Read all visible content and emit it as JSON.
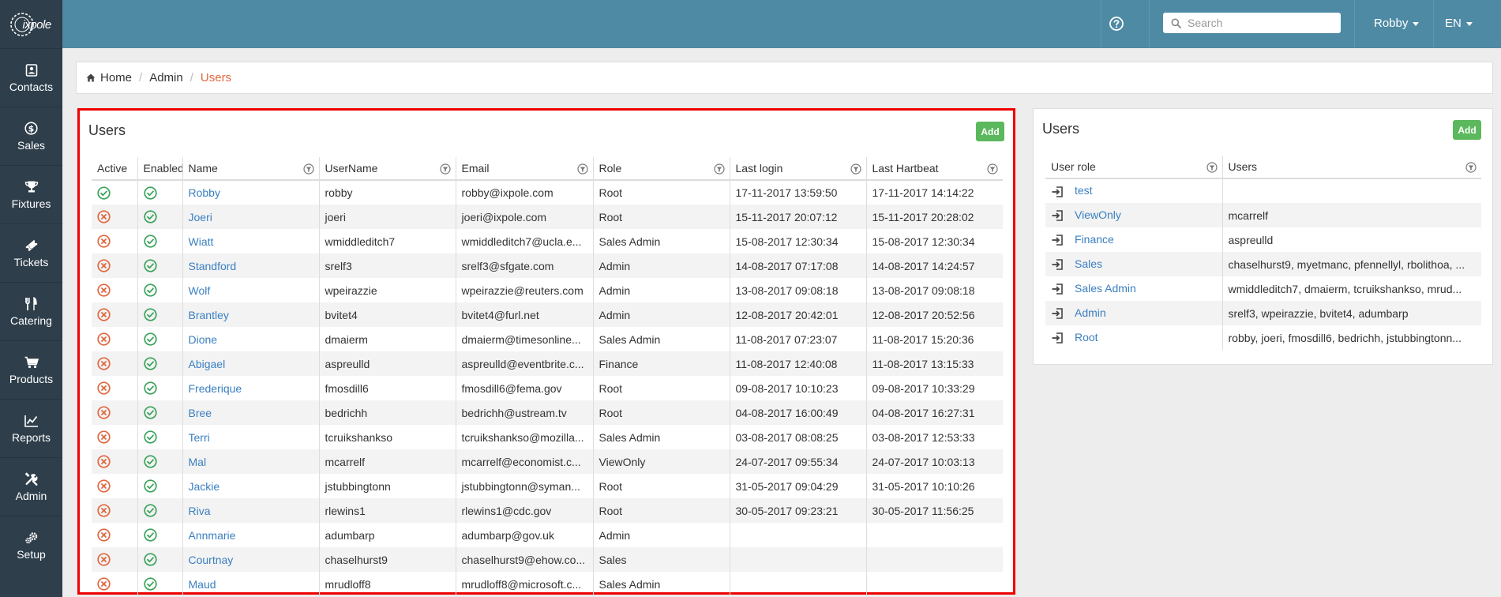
{
  "app": {
    "logo_text": "ixpole"
  },
  "sidebar": {
    "items": [
      {
        "key": "contacts",
        "label": "Contacts",
        "icon": "contact-card-icon"
      },
      {
        "key": "sales",
        "label": "Sales",
        "icon": "dollar-icon"
      },
      {
        "key": "fixtures",
        "label": "Fixtures",
        "icon": "trophy-icon"
      },
      {
        "key": "tickets",
        "label": "Tickets",
        "icon": "ticket-icon"
      },
      {
        "key": "catering",
        "label": "Catering",
        "icon": "cutlery-icon"
      },
      {
        "key": "products",
        "label": "Products",
        "icon": "cart-icon"
      },
      {
        "key": "reports",
        "label": "Reports",
        "icon": "chart-icon"
      },
      {
        "key": "admin",
        "label": "Admin",
        "icon": "tools-icon"
      },
      {
        "key": "setup",
        "label": "Setup",
        "icon": "gears-icon"
      }
    ]
  },
  "topbar": {
    "search_placeholder": "Search",
    "user_name": "Robby",
    "language": "EN"
  },
  "breadcrumb": {
    "home": "Home",
    "admin": "Admin",
    "current": "Users"
  },
  "users_panel": {
    "title": "Users",
    "add_label": "Add",
    "columns": [
      "Active",
      "Enabled",
      "Name",
      "UserName",
      "Email",
      "Role",
      "Last login",
      "Last Hartbeat"
    ],
    "rows": [
      {
        "active": true,
        "enabled": true,
        "name": "Robby",
        "username": "robby",
        "email": "robby@ixpole.com",
        "role": "Root",
        "last_login": "17-11-2017 13:59:50",
        "last_heartbeat": "17-11-2017 14:14:22"
      },
      {
        "active": false,
        "enabled": true,
        "name": "Joeri",
        "username": "joeri",
        "email": "joeri@ixpole.com",
        "role": "Root",
        "last_login": "15-11-2017 20:07:12",
        "last_heartbeat": "15-11-2017 20:28:02"
      },
      {
        "active": false,
        "enabled": true,
        "name": "Wiatt",
        "username": "wmiddleditch7",
        "email": "wmiddleditch7@ucla.e...",
        "role": "Sales Admin",
        "last_login": "15-08-2017 12:30:34",
        "last_heartbeat": "15-08-2017 12:30:34"
      },
      {
        "active": false,
        "enabled": true,
        "name": "Standford",
        "username": "srelf3",
        "email": "srelf3@sfgate.com",
        "role": "Admin",
        "last_login": "14-08-2017 07:17:08",
        "last_heartbeat": "14-08-2017 14:24:57"
      },
      {
        "active": false,
        "enabled": true,
        "name": "Wolf",
        "username": "wpeirazzie",
        "email": "wpeirazzie@reuters.com",
        "role": "Admin",
        "last_login": "13-08-2017 09:08:18",
        "last_heartbeat": "13-08-2017 09:08:18"
      },
      {
        "active": false,
        "enabled": true,
        "name": "Brantley",
        "username": "bvitet4",
        "email": "bvitet4@furl.net",
        "role": "Admin",
        "last_login": "12-08-2017 20:42:01",
        "last_heartbeat": "12-08-2017 20:52:56"
      },
      {
        "active": false,
        "enabled": true,
        "name": "Dione",
        "username": "dmaierm",
        "email": "dmaierm@timesonline...",
        "role": "Sales Admin",
        "last_login": "11-08-2017 07:23:07",
        "last_heartbeat": "11-08-2017 15:20:36"
      },
      {
        "active": false,
        "enabled": true,
        "name": "Abigael",
        "username": "aspreulld",
        "email": "aspreulld@eventbrite.c...",
        "role": "Finance",
        "last_login": "11-08-2017 12:40:08",
        "last_heartbeat": "11-08-2017 13:15:33"
      },
      {
        "active": false,
        "enabled": true,
        "name": "Frederique",
        "username": "fmosdill6",
        "email": "fmosdill6@fema.gov",
        "role": "Root",
        "last_login": "09-08-2017 10:10:23",
        "last_heartbeat": "09-08-2017 10:33:29"
      },
      {
        "active": false,
        "enabled": true,
        "name": "Bree",
        "username": "bedrichh",
        "email": "bedrichh@ustream.tv",
        "role": "Root",
        "last_login": "04-08-2017 16:00:49",
        "last_heartbeat": "04-08-2017 16:27:31"
      },
      {
        "active": false,
        "enabled": true,
        "name": "Terri",
        "username": "tcruikshankso",
        "email": "tcruikshankso@mozilla...",
        "role": "Sales Admin",
        "last_login": "03-08-2017 08:08:25",
        "last_heartbeat": "03-08-2017 12:53:33"
      },
      {
        "active": false,
        "enabled": true,
        "name": "Mal",
        "username": "mcarrelf",
        "email": "mcarrelf@economist.c...",
        "role": "ViewOnly",
        "last_login": "24-07-2017 09:55:34",
        "last_heartbeat": "24-07-2017 10:03:13"
      },
      {
        "active": false,
        "enabled": true,
        "name": "Jackie",
        "username": "jstubbingtonn",
        "email": "jstubbingtonn@syman...",
        "role": "Root",
        "last_login": "31-05-2017 09:04:29",
        "last_heartbeat": "31-05-2017 10:10:26"
      },
      {
        "active": false,
        "enabled": true,
        "name": "Riva",
        "username": "rlewins1",
        "email": "rlewins1@cdc.gov",
        "role": "Root",
        "last_login": "30-05-2017 09:23:21",
        "last_heartbeat": "30-05-2017 11:56:25"
      },
      {
        "active": false,
        "enabled": true,
        "name": "Annmarie",
        "username": "adumbarp",
        "email": "adumbarp@gov.uk",
        "role": "Admin",
        "last_login": "",
        "last_heartbeat": ""
      },
      {
        "active": false,
        "enabled": true,
        "name": "Courtnay",
        "username": "chaselhurst9",
        "email": "chaselhurst9@ehow.co...",
        "role": "Sales",
        "last_login": "",
        "last_heartbeat": ""
      },
      {
        "active": false,
        "enabled": true,
        "name": "Maud",
        "username": "mrudloff8",
        "email": "mrudloff8@microsoft.c...",
        "role": "Sales Admin",
        "last_login": "",
        "last_heartbeat": ""
      }
    ]
  },
  "roles_panel": {
    "title": "Users",
    "add_label": "Add",
    "columns": [
      "User role",
      "Users"
    ],
    "rows": [
      {
        "role": "test",
        "users": ""
      },
      {
        "role": "ViewOnly",
        "users": "mcarrelf"
      },
      {
        "role": "Finance",
        "users": "aspreulld"
      },
      {
        "role": "Sales",
        "users": "chaselhurst9, myetmanc, pfennellyl, rbolithoa, ..."
      },
      {
        "role": "Sales Admin",
        "users": "wmiddleditch7, dmaierm, tcruikshankso, mrud..."
      },
      {
        "role": "Admin",
        "users": "srelf3, wpeirazzie, bvitet4, adumbarp"
      },
      {
        "role": "Root",
        "users": "robby, joeri, fmosdill6, bedrichh, jstubbingtonn..."
      }
    ]
  },
  "colors": {
    "sidebar_bg": "#2e3e4b",
    "topbar_bg": "#4f8aa4",
    "link": "#3a7fc1",
    "active_crumb": "#e0673f",
    "inactive_status": "#e0673f",
    "enabled_status": "#3aa35b",
    "add_button": "#5cb85c",
    "highlight_border": "#ef0000"
  }
}
